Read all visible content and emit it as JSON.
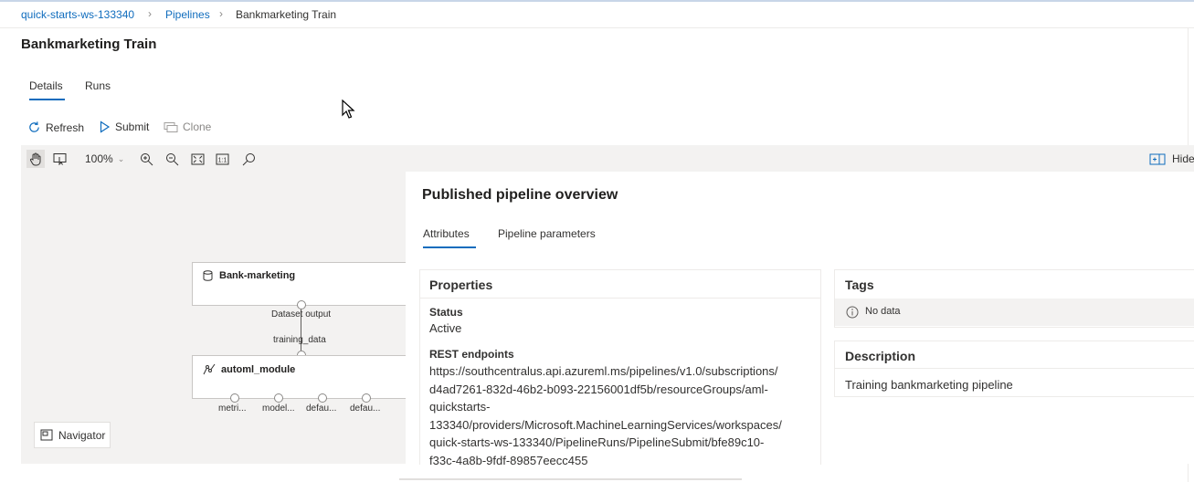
{
  "breadcrumb": {
    "items": [
      "quick-starts-ws-133340",
      "Pipelines",
      "Bankmarketing Train"
    ],
    "separator": ">"
  },
  "page": {
    "title": "Bankmarketing Train"
  },
  "tabs": [
    {
      "label": "Details",
      "selected": true
    },
    {
      "label": "Runs",
      "selected": false
    }
  ],
  "commands": {
    "refresh": "Refresh",
    "submit": "Submit",
    "clone": "Clone"
  },
  "toolbar": {
    "zoom": "100%",
    "hide": "Hide"
  },
  "graph": {
    "dataset_node": "Bank-marketing",
    "dataset_output": "Dataset output",
    "training_input": "training_data",
    "automl_node": "automl_module",
    "output_ports": [
      "metri...",
      "model...",
      "defau...",
      "defau..."
    ],
    "navigator": "Navigator"
  },
  "overview": {
    "title": "Published pipeline overview",
    "tabs": [
      {
        "label": "Attributes",
        "selected": true
      },
      {
        "label": "Pipeline parameters",
        "selected": false
      }
    ],
    "properties": {
      "heading": "Properties",
      "status_label": "Status",
      "status_value": "Active",
      "rest_label": "REST endpoints",
      "rest_lines": [
        "https://southcentralus.api.azureml.ms/pipelines/v1.0/subscriptions/",
        "d4ad7261-832d-46b2-b093-22156001df5b/resourceGroups/aml-",
        "quickstarts-",
        "133340/providers/Microsoft.MachineLearningServices/workspaces/",
        "quick-starts-ws-133340/PipelineRuns/PipelineSubmit/bfe89c10-",
        "f33c-4a8b-9fdf-89857eecc455"
      ]
    },
    "tags": {
      "heading": "Tags",
      "empty": "No data"
    },
    "description": {
      "heading": "Description",
      "value": "Training bankmarketing pipeline"
    }
  },
  "colors": {
    "accent": "#0f6cbd",
    "canvas_bg": "#f3f2f1",
    "text": "#323130"
  }
}
